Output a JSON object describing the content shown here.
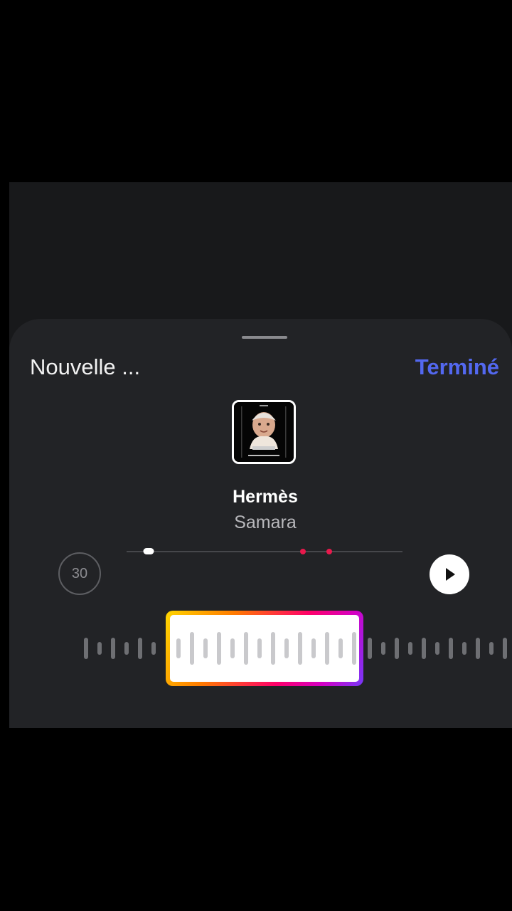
{
  "sheet": {
    "title": "Nouvelle ...",
    "done_label": "Terminé"
  },
  "track": {
    "name": "Hermès",
    "artist": "Samara",
    "cover_icon": "album-cover-image"
  },
  "controls": {
    "duration_label": "30",
    "play_icon": "play-icon",
    "progress_fraction": 0.08,
    "marker_fractions": [
      0.64,
      0.735
    ]
  },
  "colors": {
    "accent": "#5368f0",
    "marker": "#e8194c",
    "sheet_background": "#222326",
    "selection_gradient": [
      "#ffd600",
      "#ff7a00",
      "#ff0069",
      "#d300c5",
      "#7638fa"
    ]
  }
}
